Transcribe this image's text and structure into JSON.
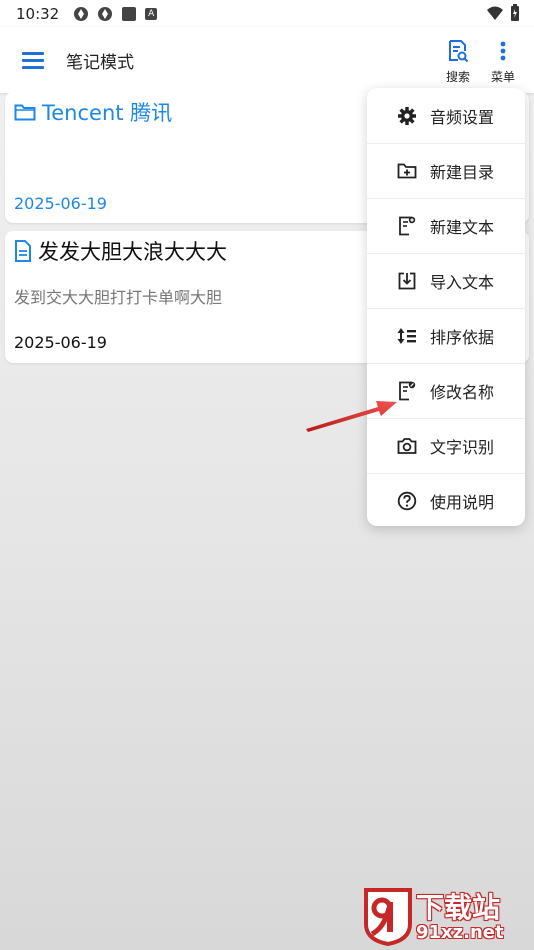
{
  "status_bar": {
    "time": "10:32",
    "badge_letter": "A"
  },
  "app_bar": {
    "title": "笔记模式",
    "search_label": "搜索",
    "menu_label": "菜单"
  },
  "notes": [
    {
      "kind": "folder",
      "title": "Tencent 腾讯",
      "date": "2025-06-19"
    },
    {
      "kind": "document",
      "title": "发发大胆大浪大大大",
      "preview": "发到交大大胆打打卡单啊大胆",
      "date": "2025-06-19"
    }
  ],
  "popup_menu": {
    "items": [
      {
        "label": "音频设置",
        "icon": "gear-icon"
      },
      {
        "label": "新建目录",
        "icon": "folder-plus-icon"
      },
      {
        "label": "新建文本",
        "icon": "note-add-icon"
      },
      {
        "label": "导入文本",
        "icon": "import-icon"
      },
      {
        "label": "排序依据",
        "icon": "sort-icon"
      },
      {
        "label": "修改名称",
        "icon": "rename-icon"
      },
      {
        "label": "文字识别",
        "icon": "camera-icon"
      },
      {
        "label": "使用说明",
        "icon": "help-icon"
      }
    ]
  },
  "watermark": {
    "line1": "下载站",
    "line2": "91xz.net"
  },
  "colors": {
    "accent": "#1e88e5",
    "arrow": "#d32f2f",
    "watermark": "#c62828"
  }
}
